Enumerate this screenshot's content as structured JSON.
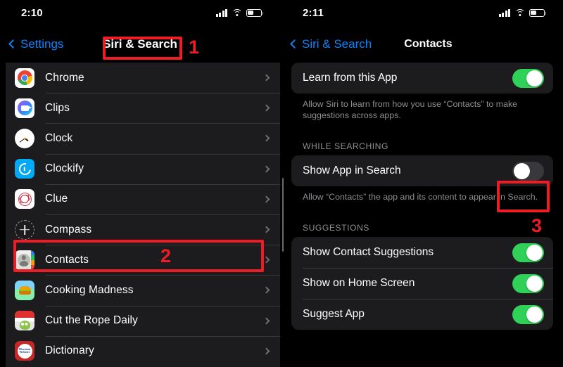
{
  "left": {
    "status": {
      "time": "2:10",
      "battery_level_pct": 40,
      "signal_bars": 4,
      "icons": [
        "cellular-signal-icon",
        "wifi-icon",
        "battery-icon"
      ]
    },
    "nav": {
      "back_label": "Settings",
      "title": "Siri & Search"
    },
    "list": [
      {
        "label": "Chrome",
        "icon": "chrome-app-icon"
      },
      {
        "label": "Clips",
        "icon": "clips-app-icon"
      },
      {
        "label": "Clock",
        "icon": "clock-app-icon"
      },
      {
        "label": "Clockify",
        "icon": "clockify-app-icon"
      },
      {
        "label": "Clue",
        "icon": "clue-app-icon"
      },
      {
        "label": "Compass",
        "icon": "compass-app-icon"
      },
      {
        "label": "Contacts",
        "icon": "contacts-app-icon"
      },
      {
        "label": "Cooking Madness",
        "icon": "cooking-madness-app-icon"
      },
      {
        "label": "Cut the Rope Daily",
        "icon": "cut-the-rope-daily-app-icon"
      },
      {
        "label": "Dictionary",
        "icon": "dictionary-app-icon"
      }
    ],
    "dictionary_icon_text": "Merriam Webster"
  },
  "right": {
    "status": {
      "time": "2:11",
      "battery_level_pct": 40,
      "signal_bars": 4,
      "icons": [
        "cellular-signal-icon",
        "wifi-icon",
        "battery-icon"
      ]
    },
    "nav": {
      "back_label": "Siri & Search",
      "title": "Contacts"
    },
    "learn": {
      "label": "Learn from this App",
      "toggle_state": "on",
      "footnote": "Allow Siri to learn from how you use “Contacts” to make suggestions across apps."
    },
    "while_searching": {
      "header": "WHILE SEARCHING",
      "label": "Show App in Search",
      "toggle_state": "off",
      "footnote": "Allow “Contacts” the app and its content to appear in Search."
    },
    "suggestions": {
      "header": "SUGGESTIONS",
      "rows": [
        {
          "label": "Show Contact Suggestions",
          "toggle_state": "on"
        },
        {
          "label": "Show on Home Screen",
          "toggle_state": "on"
        },
        {
          "label": "Suggest App",
          "toggle_state": "on"
        }
      ]
    }
  },
  "annotations": {
    "color": "#ee1c25",
    "items": [
      {
        "number": "1",
        "target": "siri-and-search-title"
      },
      {
        "number": "2",
        "target": "contacts-list-row"
      },
      {
        "number": "3",
        "target": "show-app-in-search-toggle"
      }
    ]
  }
}
